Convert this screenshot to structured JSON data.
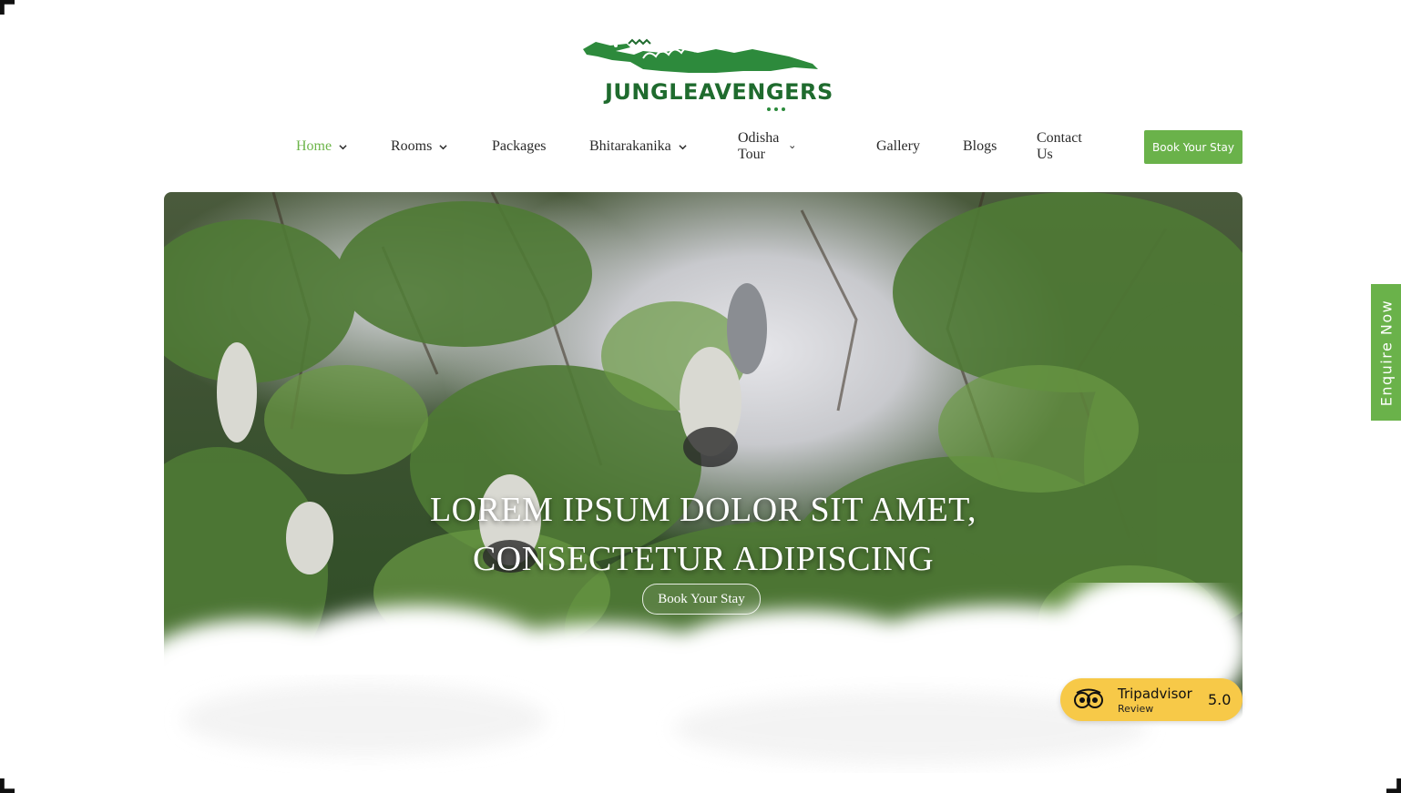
{
  "logo": {
    "text": "JUNGLEAVENGERS",
    "icon": "crocodile-logo-icon",
    "color": "#1f6b2e"
  },
  "nav": {
    "items": [
      {
        "label": "Home",
        "dropdown": true,
        "active": true
      },
      {
        "label": "Rooms",
        "dropdown": true
      },
      {
        "label": "Packages",
        "dropdown": false
      },
      {
        "label": "Bhitarakanika",
        "dropdown": true
      },
      {
        "label": "Odisha Tour",
        "dropdown": true
      },
      {
        "label": "Gallery",
        "dropdown": false
      },
      {
        "label": "Blogs",
        "dropdown": false
      },
      {
        "label": "Contact Us",
        "dropdown": false
      }
    ],
    "cta_label": "Book Your Stay"
  },
  "hero": {
    "title_line1": "LOREM IPSUM DOLOR SIT AMET,",
    "title_line2": "CONSECTETUR ADIPISCING",
    "button_label": "Book Your Stay"
  },
  "enquire_label": "Enquire Now",
  "tripadvisor": {
    "name": "Tripadvisor",
    "sub": "Review",
    "score": "5.0",
    "icon": "tripadvisor-owl-icon"
  },
  "colors": {
    "accent": "#6ab24a",
    "active_nav": "#6db54a",
    "badge": "#f7c948"
  }
}
